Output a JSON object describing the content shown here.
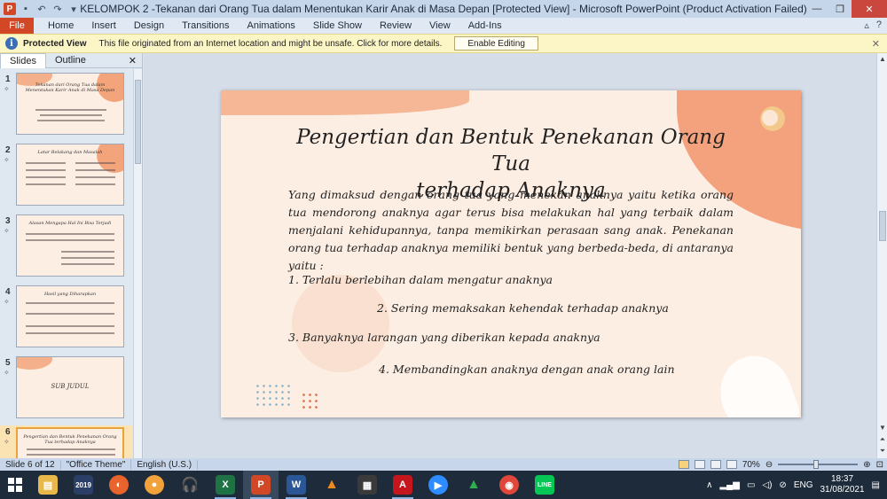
{
  "window": {
    "title": "KELOMPOK 2 -Tekanan dari Orang Tua dalam Menentukan Karir Anak di Masa Depan  [Protected View]  -  Microsoft PowerPoint (Product Activation Failed)"
  },
  "ribbon": {
    "file_label": "File",
    "tabs": [
      "Home",
      "Insert",
      "Design",
      "Transitions",
      "Animations",
      "Slide Show",
      "Review",
      "View",
      "Add-Ins"
    ]
  },
  "protected_view": {
    "title": "Protected View",
    "message": "This file originated from an Internet location and might be unsafe. Click for more details.",
    "button": "Enable Editing"
  },
  "left_pane": {
    "tabs": [
      "Slides",
      "Outline"
    ],
    "thumbnails": [
      {
        "num": "1",
        "title": "Tekanan dari Orang Tua dalam Menentukan Karir Anak di Masa Depan"
      },
      {
        "num": "2",
        "title": "Latar Belakang dan Masalah"
      },
      {
        "num": "3",
        "title": "Alasan Mengapa Hal Ini Bisa Terjadi"
      },
      {
        "num": "4",
        "title": "Hasil yang Diharapkan"
      },
      {
        "num": "5",
        "title": "SUB JUDUL"
      },
      {
        "num": "6",
        "title": "Pengertian dan Bentuk Penekanan Orang Tua terhadap Anaknya"
      }
    ]
  },
  "slide": {
    "title_line1": "Pengertian dan Bentuk Penekanan Orang Tua",
    "title_line2": "terhadap Anaknya",
    "body": "Yang dimaksud dengan orang tua yang menekan anaknya yaitu ketika orang tua mendorong anaknya agar terus bisa melakukan hal yang terbaik dalam menjalani kehidupannya, tanpa memikirkan perasaan sang anak. Penekanan orang tua terhadap anaknya memiliki bentuk yang berbeda-beda, di antaranya yaitu :",
    "items": [
      "1. Terlalu berlebihan dalam mengatur anaknya",
      "2. Sering memaksakan kehendak terhadap anaknya",
      "3. Banyaknya larangan yang diberikan kepada anaknya",
      "4. Membandingkan anaknya dengan anak orang lain"
    ]
  },
  "status": {
    "slide_info": "Slide 6 of 12",
    "theme": "\"Office Theme\"",
    "language": "English (U.S.)",
    "zoom": "70%"
  },
  "taskbar": {
    "language": "ENG",
    "time": "18:37",
    "date": "31/08/2021",
    "calendar_badge": "2019"
  },
  "colors": {
    "accent_file": "#d24726",
    "slide_bg": "#fdeee3",
    "slide_accent": "#f4a27d"
  }
}
